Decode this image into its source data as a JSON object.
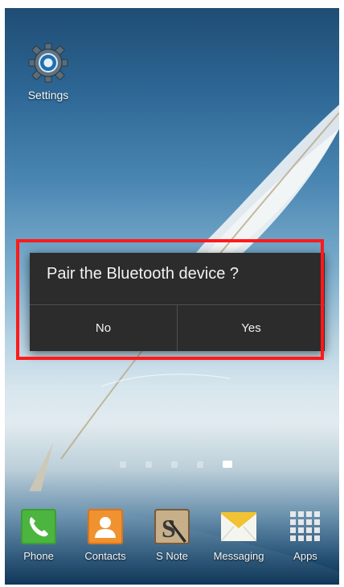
{
  "home": {
    "shortcut": {
      "icon": "gear-icon",
      "label": "Settings"
    }
  },
  "dialog": {
    "title": "Pair the Bluetooth device ?",
    "no_label": "No",
    "yes_label": "Yes",
    "highlight_color": "#ff1a1a"
  },
  "page_indicator": {
    "pages": 5,
    "active_index": 4
  },
  "dock": {
    "items": [
      {
        "label": "Phone",
        "icon": "phone-icon",
        "color": "#3c9e34"
      },
      {
        "label": "Contacts",
        "icon": "contacts-icon",
        "color": "#e8862a"
      },
      {
        "label": "S Note",
        "icon": "s-note-icon",
        "color": "#8a6a4a"
      },
      {
        "label": "Messaging",
        "icon": "messaging-icon",
        "color": "#f1c232"
      },
      {
        "label": "Apps",
        "icon": "apps-grid-icon",
        "color": "#e6e6e6"
      }
    ]
  }
}
